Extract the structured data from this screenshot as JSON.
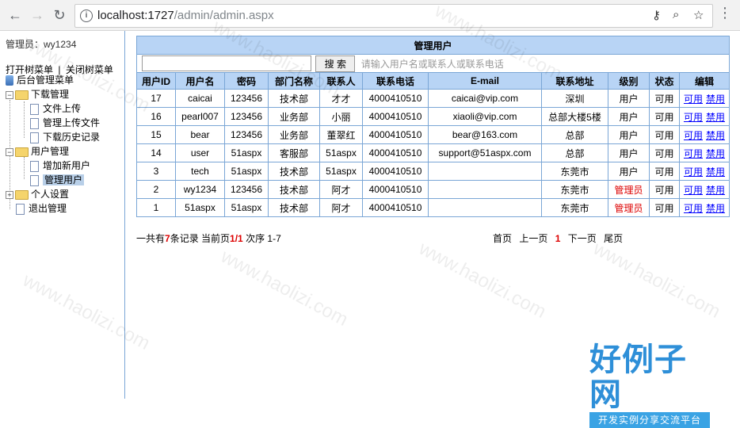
{
  "browser": {
    "url_host": "localhost:1727",
    "url_path": "/admin/admin.aspx",
    "back_icon": "←",
    "forward_icon": "→",
    "reload_icon": "↻"
  },
  "sidebar": {
    "admin_label": "管理员：wy1234",
    "open_tree": "打开树菜单",
    "separator": "|",
    "close_tree": "关闭树菜单",
    "root": "后台管理菜单",
    "groups": [
      {
        "label": "下载管理",
        "items": [
          "文件上传",
          "管理上传文件",
          "下载历史记录"
        ]
      },
      {
        "label": "用户管理",
        "items": [
          "增加新用户",
          "管理用户"
        ]
      },
      {
        "label": "个人设置",
        "items": []
      }
    ],
    "logout": "退出管理"
  },
  "main": {
    "title": "管理用户",
    "search_value": "",
    "search_button": "搜 索",
    "search_hint": "请输入用户名或联系人或联系电话",
    "columns": [
      "用户ID",
      "用户名",
      "密码",
      "部门名称",
      "联系人",
      "联系电话",
      "E-mail",
      "联系地址",
      "级别",
      "状态",
      "编辑"
    ],
    "rows": [
      {
        "id": "17",
        "username": "caicai",
        "password": "123456",
        "dept": "技术部",
        "contact": "才才",
        "phone": "4000410510",
        "email": "caicai@vip.com",
        "address": "深圳",
        "level": "用户",
        "status": "可用"
      },
      {
        "id": "16",
        "username": "pearl007",
        "password": "123456",
        "dept": "业务部",
        "contact": "小丽",
        "phone": "4000410510",
        "email": "xiaoli@vip.com",
        "address": "总部大楼5楼",
        "level": "用户",
        "status": "可用"
      },
      {
        "id": "15",
        "username": "bear",
        "password": "123456",
        "dept": "业务部",
        "contact": "董翠红",
        "phone": "4000410510",
        "email": "bear@163.com",
        "address": "总部",
        "level": "用户",
        "status": "可用"
      },
      {
        "id": "14",
        "username": "user",
        "password": "51aspx",
        "dept": "客服部",
        "contact": "51aspx",
        "phone": "4000410510",
        "email": "support@51aspx.com",
        "address": "总部",
        "level": "用户",
        "status": "可用"
      },
      {
        "id": "3",
        "username": "tech",
        "password": "51aspx",
        "dept": "技术部",
        "contact": "51aspx",
        "phone": "4000410510",
        "email": "",
        "address": "东莞市",
        "level": "用户",
        "status": "可用"
      },
      {
        "id": "2",
        "username": "wy1234",
        "password": "123456",
        "dept": "技术部",
        "contact": "阿才",
        "phone": "4000410510",
        "email": "",
        "address": "东莞市",
        "level": "管理员",
        "status": "可用"
      },
      {
        "id": "1",
        "username": "51aspx",
        "password": "51aspx",
        "dept": "技术部",
        "contact": "阿才",
        "phone": "4000410510",
        "email": "",
        "address": "东莞市",
        "level": "管理员",
        "status": "可用"
      }
    ],
    "edit_enable": "可用",
    "edit_disable": "禁用"
  },
  "footer": {
    "total_prefix": "一共有",
    "total": "7",
    "total_suffix": "条记录 当前页",
    "page": "1/1",
    "order_label": " 次序 1-7",
    "first": "首页",
    "prev": "上一页",
    "current": "1",
    "next": "下一页",
    "last": "尾页"
  },
  "watermark": {
    "text": "www.haolizi.com",
    "logo_main": "好例子网",
    "logo_sub": "开发实例分享交流平台"
  },
  "colors": {
    "header_bg": "#b8d4f5",
    "border": "#7aa6d6",
    "admin_level": "#dd0000",
    "link": "#0000ff"
  }
}
